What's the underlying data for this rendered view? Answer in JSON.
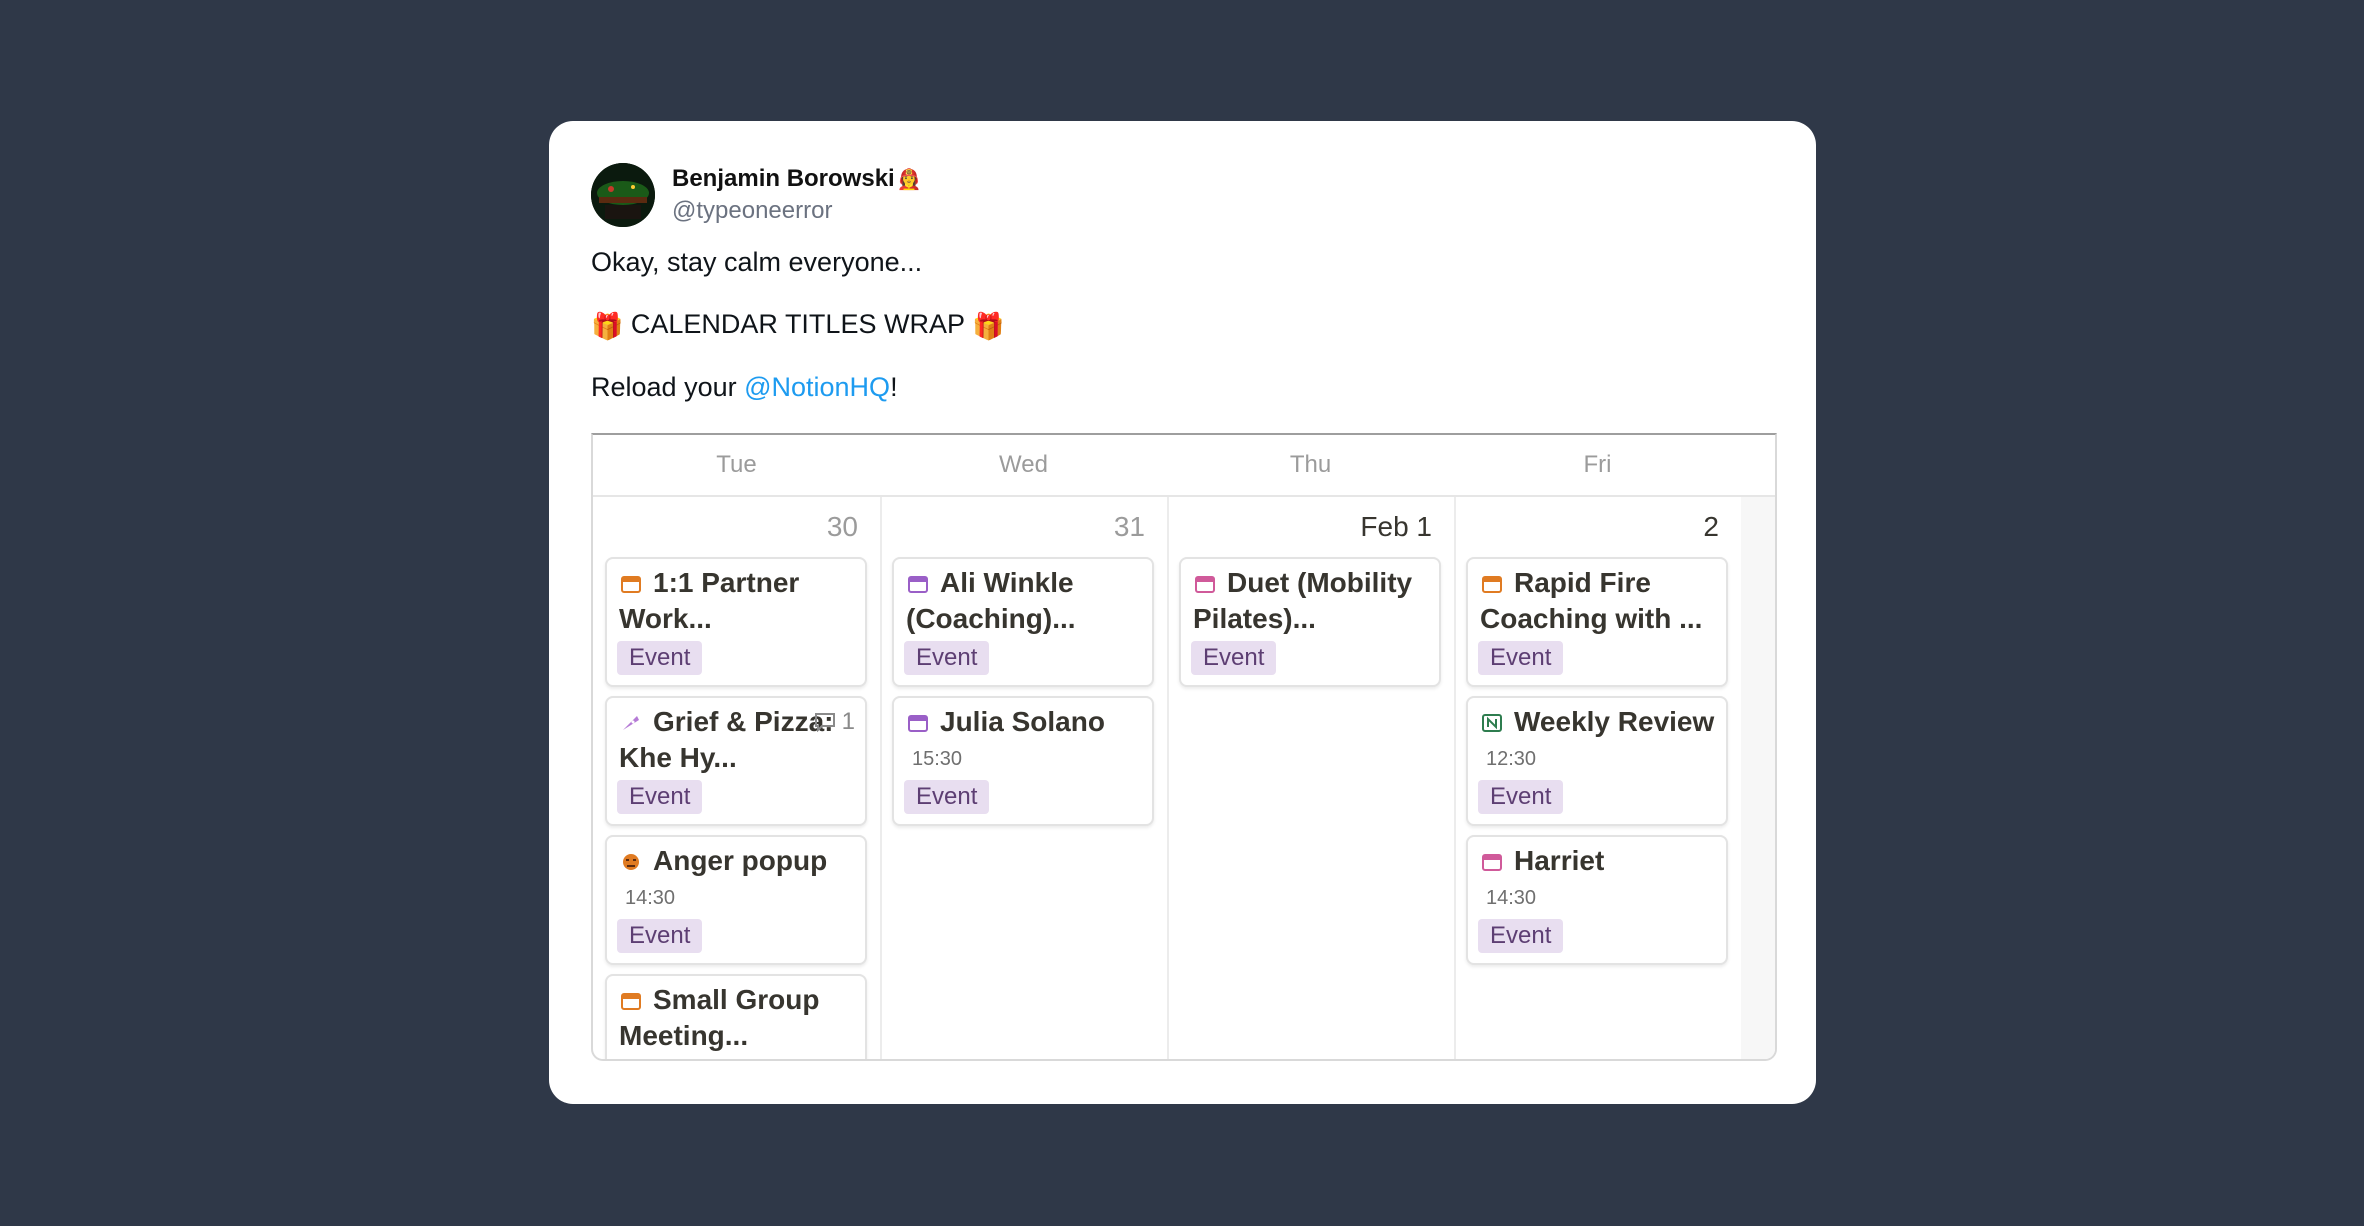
{
  "tweet": {
    "author_name": "Benjamin Borowski",
    "author_emoji": "👩‍🚒",
    "handle": "@typeoneerror",
    "line1": "Okay, stay calm everyone...",
    "line2_icon_left": "🎁",
    "line2_text": "CALENDAR TITLES WRAP",
    "line2_icon_right": "🎁",
    "line3_prefix": "Reload your ",
    "line3_mention": "@NotionHQ",
    "line3_suffix": "!"
  },
  "calendar": {
    "days": [
      "Tue",
      "Wed",
      "Thu",
      "Fri"
    ],
    "dates": [
      "30",
      "31",
      "Feb 1",
      "2"
    ],
    "events": {
      "tue": [
        {
          "title": "1:1 Partner Work...",
          "icon": "calendar-icon",
          "tag": "Event"
        },
        {
          "title": "Grief & Pizza: Khe Hy...",
          "icon": "pizza-icon",
          "tag": "Event",
          "comments": "1"
        },
        {
          "title": "Anger popup",
          "icon": "angry-face-icon",
          "time": "14:30",
          "tag": "Event"
        },
        {
          "title": "Small Group Meeting...",
          "icon": "calendar-icon"
        }
      ],
      "wed": [
        {
          "title": "Ali Winkle (Coaching)...",
          "icon": "calendar-icon",
          "tag": "Event"
        },
        {
          "title": "Julia Solano",
          "icon": "calendar-icon",
          "time": "15:30",
          "tag": "Event"
        }
      ],
      "thu": [
        {
          "title": "Duet (Mobility Pilates)...",
          "icon": "calendar-icon",
          "tag": "Event"
        }
      ],
      "fri": [
        {
          "title": "Rapid Fire Coaching with ...",
          "icon": "calendar-icon",
          "tag": "Event"
        },
        {
          "title": "Weekly Review",
          "icon": "notion-icon",
          "time": "12:30",
          "tag": "Event"
        },
        {
          "title": "Harriet",
          "icon": "calendar-icon",
          "time": "14:30",
          "tag": "Event"
        }
      ]
    }
  },
  "colors": {
    "background": "#2f3848",
    "mention": "#1d9bf0",
    "tag_bg": "#e8def0",
    "icon_orange": "#e07b22",
    "icon_purple": "#9a5fc7",
    "icon_pink": "#d05a9a"
  }
}
